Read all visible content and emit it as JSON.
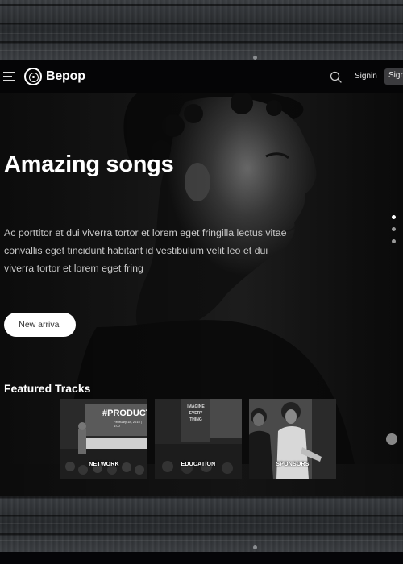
{
  "brand": {
    "name": "Bepop"
  },
  "header": {
    "signin_label": "Signin",
    "signup_label": "Signup"
  },
  "hero": {
    "title": "Amazing songs",
    "description": "Ac porttitor et dui viverra tortor et lorem eget fringilla lectus vitae convallis eget tincidunt habitant id vestibulum velit leo et dui viverra tortor et lorem eget fring",
    "button_label": "New arrival",
    "slides": 3,
    "active_slide": 1
  },
  "featured": {
    "title": "Featured Tracks",
    "cards": [
      {
        "label": "NETWORK",
        "overlay": "#PRODUCT",
        "sub": "February 18, 2015 | 1:00"
      },
      {
        "label": "EDUCATION",
        "overlay": "IMAGINE EVERY THING"
      },
      {
        "label": "SPONSORS"
      }
    ]
  },
  "colors": {
    "header_bg": "#050506",
    "accent_white": "#ffffff",
    "wood": "#32353a"
  },
  "icons": [
    "menu-icon",
    "vinyl-logo-icon",
    "search-icon"
  ]
}
